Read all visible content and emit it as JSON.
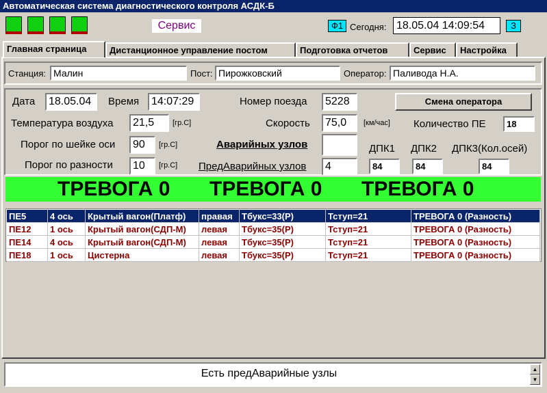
{
  "window": {
    "title": "Автоматическая система диагностического контроля АСДК-Б"
  },
  "header": {
    "indicators": [
      {
        "color": "#10d010",
        "alert": "#b00000"
      },
      {
        "color": "#10d010",
        "alert": "#b00000"
      },
      {
        "color": "#10d010",
        "alert": "#b00000"
      },
      {
        "color": "#10d010",
        "alert": "#b00000"
      }
    ],
    "mode_label": "Сервис",
    "f1_label": "Ф1",
    "today_label": "Сегодня:",
    "today_value": "18.05.04 14:09:54",
    "z_label": "З"
  },
  "tabs": [
    {
      "label": "Главная страница",
      "active": true
    },
    {
      "label": "Дистанционное управление постом",
      "active": false
    },
    {
      "label": "Подготовка отчетов",
      "active": false
    },
    {
      "label": "Сервис",
      "active": false
    },
    {
      "label": "Настройка",
      "active": false
    }
  ],
  "station": {
    "station_label": "Станция:",
    "station_value": "Малин",
    "post_label": "Пост:",
    "post_value": "Пирожковский",
    "operator_label": "Оператор:",
    "operator_value": "Паливода Н.А."
  },
  "params": {
    "date_label": "Дата",
    "date_value": "18.05.04",
    "time_label": "Время",
    "time_value": "14:07:29",
    "train_label": "Номер поезда",
    "train_value": "5228",
    "change_operator_button": "Смена оператора",
    "air_temp_label": "Температура воздуха",
    "air_temp_value": "21,5",
    "air_temp_unit": "[гр.С]",
    "speed_label": "Скорость",
    "speed_value": "75,0",
    "speed_unit": "[км/час]",
    "pe_count_label": "Количество ПЕ",
    "pe_count_value": "18",
    "axle_threshold_label": "Порог по шейке оси",
    "axle_threshold_value": "90",
    "axle_threshold_unit": "[гр.С]",
    "emergency_label": "Аварийных узлов",
    "emergency_value": "",
    "diff_threshold_label": "Порог по разности",
    "diff_threshold_value": "10",
    "diff_threshold_unit": "[гр.С]",
    "pre_emergency_label": "ПредАварийных узлов",
    "pre_emergency_value": "4",
    "dpk1_label": "ДПК1",
    "dpk1_value": "84",
    "dpk2_label": "ДПК2",
    "dpk2_value": "84",
    "dpk3_label": "ДПК3(Кол.осей)",
    "dpk3_value": "84"
  },
  "alarm": {
    "color": "#33ff33",
    "items": [
      "ТРЕВОГА 0",
      "ТРЕВОГА 0",
      "ТРЕВОГА 0"
    ]
  },
  "table": {
    "rows": [
      {
        "pe": "ПЕ5",
        "axle": "4 ось",
        "car": "Крытый вагон(Платф)",
        "side": "правая",
        "tbuks": "Тбукс=33(Р)",
        "tstup": "Тступ=21",
        "alarm": "ТРЕВОГА 0 (Разность)",
        "selected": true
      },
      {
        "pe": "ПЕ12",
        "axle": "1 ось",
        "car": "Крытый вагон(СДП-М)",
        "side": "левая",
        "tbuks": "Тбукс=35(Р)",
        "tstup": "Тступ=21",
        "alarm": "ТРЕВОГА 0 (Разность)",
        "selected": false
      },
      {
        "pe": "ПЕ14",
        "axle": "4 ось",
        "car": "Крытый вагон(СДП-М)",
        "side": "левая",
        "tbuks": "Тбукс=35(Р)",
        "tstup": "Тступ=21",
        "alarm": "ТРЕВОГА 0 (Разность)",
        "selected": false
      },
      {
        "pe": "ПЕ18",
        "axle": "1 ось",
        "car": "Цистерна",
        "side": "левая",
        "tbuks": "Тбукс=35(Р)",
        "tstup": "Тступ=21",
        "alarm": "ТРЕВОГА 0 (Разность)",
        "selected": false
      }
    ]
  },
  "status": {
    "message": "Есть предАварийные узлы"
  }
}
